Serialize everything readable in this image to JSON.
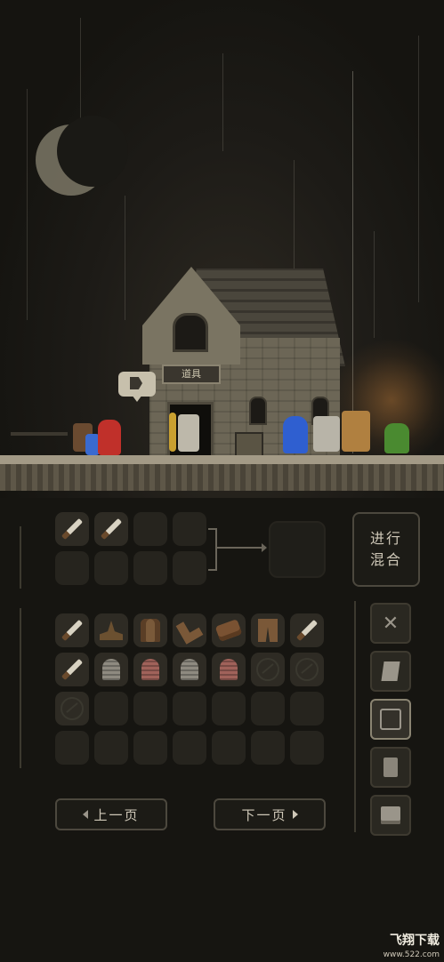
{
  "scene": {
    "shop_sign": "道具"
  },
  "mix_panel": {
    "input_slots": [
      "sword",
      "sword",
      "",
      "",
      "",
      "",
      "",
      ""
    ],
    "mix_button_line1": "进行",
    "mix_button_line2": "混合"
  },
  "inventory": {
    "rows": [
      [
        "sword",
        "hat",
        "cloak",
        "boot",
        "log",
        "pants",
        "sword"
      ],
      [
        "sword",
        "tomb-gray",
        "tomb-red",
        "tomb-gray",
        "tomb-red",
        "ring",
        "ring"
      ],
      [
        "ring",
        "",
        "",
        "",
        "",
        "",
        ""
      ],
      [
        "",
        "",
        "",
        "",
        "",
        "",
        ""
      ]
    ]
  },
  "side_menu": {
    "items": [
      "crossed-swords-icon",
      "scroll-icon",
      "backpack-icon",
      "document-icon",
      "screen-icon"
    ],
    "selected_index": 2
  },
  "pager": {
    "prev_label": "上一页",
    "next_label": "下一页"
  },
  "watermark": {
    "title": "飞翔下载",
    "url": "www.522.com"
  },
  "colors": {
    "background": "#171612",
    "slot": "#26241e",
    "border": "#4c483e",
    "text": "#cfc8b8"
  }
}
